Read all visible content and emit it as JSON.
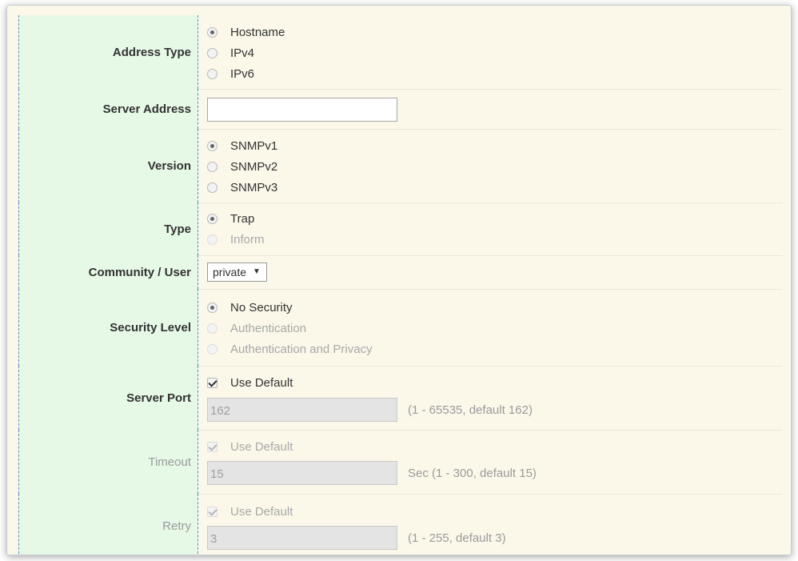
{
  "form": {
    "address_type": {
      "label": "Address Type",
      "options": [
        {
          "label": "Hostname",
          "checked": true,
          "enabled": true
        },
        {
          "label": "IPv4",
          "checked": false,
          "enabled": true
        },
        {
          "label": "IPv6",
          "checked": false,
          "enabled": true
        }
      ]
    },
    "server_address": {
      "label": "Server Address",
      "value": ""
    },
    "version": {
      "label": "Version",
      "options": [
        {
          "label": "SNMPv1",
          "checked": true,
          "enabled": true
        },
        {
          "label": "SNMPv2",
          "checked": false,
          "enabled": true
        },
        {
          "label": "SNMPv3",
          "checked": false,
          "enabled": true
        }
      ]
    },
    "type": {
      "label": "Type",
      "options": [
        {
          "label": "Trap",
          "checked": true,
          "enabled": true
        },
        {
          "label": "Inform",
          "checked": false,
          "enabled": false
        }
      ]
    },
    "community_user": {
      "label": "Community / User",
      "selected": "private"
    },
    "security_level": {
      "label": "Security Level",
      "options": [
        {
          "label": "No Security",
          "checked": true,
          "enabled": true
        },
        {
          "label": "Authentication",
          "checked": false,
          "enabled": false
        },
        {
          "label": "Authentication and Privacy",
          "checked": false,
          "enabled": false
        }
      ]
    },
    "server_port": {
      "label": "Server Port",
      "use_default_label": "Use Default",
      "use_default_checked": true,
      "value": "162",
      "hint": "(1 - 65535, default 162)"
    },
    "timeout": {
      "label": "Timeout",
      "use_default_label": "Use Default",
      "use_default_checked": true,
      "value": "15",
      "hint": "Sec (1 - 300, default 15)"
    },
    "retry": {
      "label": "Retry",
      "use_default_label": "Use Default",
      "use_default_checked": true,
      "value": "3",
      "hint": "(1 - 255, default 3)"
    }
  }
}
